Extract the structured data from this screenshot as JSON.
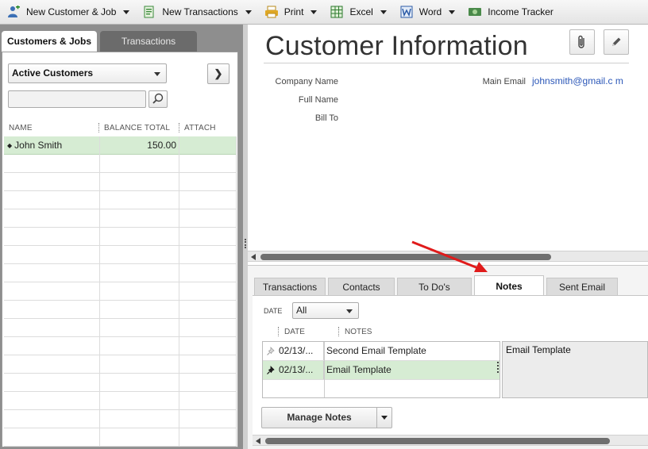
{
  "toolbar": {
    "items": [
      {
        "label": "New Customer & Job",
        "icon": "person-add-icon",
        "dropdown": true
      },
      {
        "label": "New Transactions",
        "icon": "document-plus-icon",
        "dropdown": true
      },
      {
        "label": "Print",
        "icon": "printer-icon",
        "dropdown": true
      },
      {
        "label": "Excel",
        "icon": "excel-icon",
        "dropdown": true
      },
      {
        "label": "Word",
        "icon": "word-icon",
        "dropdown": true
      },
      {
        "label": "Income Tracker",
        "icon": "money-icon",
        "dropdown": false
      }
    ]
  },
  "left_panel": {
    "tabs": [
      {
        "label": "Customers & Jobs",
        "active": true
      },
      {
        "label": "Transactions",
        "active": false
      }
    ],
    "filter": {
      "selected": "Active Customers"
    },
    "search": {
      "value": "",
      "placeholder": ""
    },
    "columns": [
      "NAME",
      "BALANCE TOTAL",
      "ATTACH"
    ],
    "rows": [
      {
        "name": "John Smith",
        "balance": "150.00",
        "attach": ""
      }
    ]
  },
  "customer_info": {
    "title": "Customer Information",
    "fields": {
      "company_name_label": "Company Name",
      "full_name_label": "Full Name",
      "bill_to_label": "Bill To",
      "main_email_label": "Main Email",
      "main_email_value": "johnsmith@gmail.c m"
    }
  },
  "bottom_tabs": [
    {
      "label": "Transactions",
      "active": false
    },
    {
      "label": "Contacts",
      "active": false
    },
    {
      "label": "To Do's",
      "active": false
    },
    {
      "label": "Notes",
      "active": true
    },
    {
      "label": "Sent Email",
      "active": false
    }
  ],
  "notes": {
    "date_filter_label": "DATE",
    "date_filter_value": "All",
    "columns": [
      "DATE",
      "NOTES"
    ],
    "rows": [
      {
        "date": "02/13/...",
        "note": "Second Email Template",
        "pinned": false,
        "selected": false
      },
      {
        "date": "02/13/...",
        "note": "Email Template",
        "pinned": true,
        "selected": true
      }
    ],
    "preview": "Email Template",
    "manage_button": "Manage Notes"
  },
  "colors": {
    "selected_row": "#d6ecd3",
    "email_link": "#2b57b8",
    "annotation_arrow": "#e01b1b"
  }
}
